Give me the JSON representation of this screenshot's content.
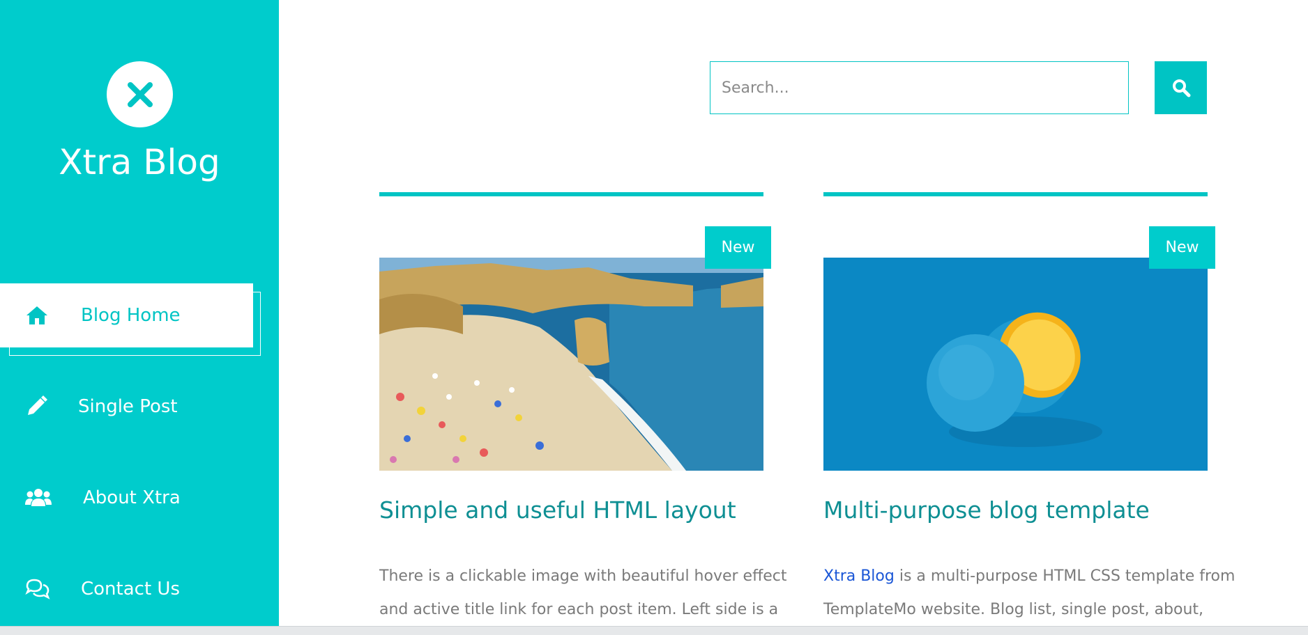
{
  "brand": {
    "title": "Xtra Blog",
    "logo_icon": "x-icon"
  },
  "colors": {
    "accent": "#00cccc",
    "title": "#0e8f93",
    "text": "#7a7a7a",
    "link": "#1a56d6"
  },
  "nav": {
    "items": [
      {
        "label": "Blog Home",
        "icon": "home-icon",
        "active": true
      },
      {
        "label": "Single Post",
        "icon": "pencil-icon",
        "active": false
      },
      {
        "label": "About Xtra",
        "icon": "users-icon",
        "active": false
      },
      {
        "label": "Contact Us",
        "icon": "comments-icon",
        "active": false
      }
    ]
  },
  "search": {
    "placeholder": "Search...",
    "button_icon": "search-icon"
  },
  "posts": [
    {
      "badge": "New",
      "title": "Simple and useful HTML layout",
      "text_line1": "There is a clickable image with beautiful hover effect",
      "text_line2": "and active title link for each post item. Left side is a"
    },
    {
      "badge": "New",
      "title": "Multi-purpose blog template",
      "link_text": "Xtra Blog",
      "text_line1_rest": " is a multi-purpose HTML CSS template from",
      "text_line2": "TemplateMo website. Blog list, single post, about,"
    }
  ]
}
